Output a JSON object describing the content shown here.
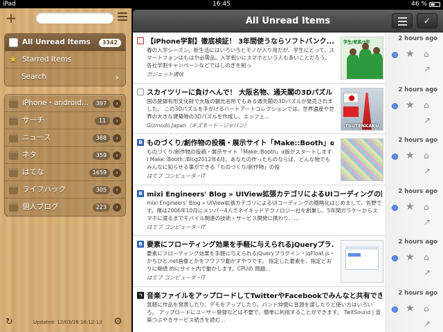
{
  "status_bar": {
    "device": "iPad",
    "time": "16:45",
    "battery": "46 %"
  },
  "sidebar": {
    "top_items": [
      {
        "label": "All Unread Items",
        "count": "3342"
      },
      {
        "label": "Starred Items"
      },
      {
        "label": "Search"
      }
    ],
    "folders": [
      {
        "label": "iPhone・android...",
        "count": "397"
      },
      {
        "label": "サーチ",
        "count": "11"
      },
      {
        "label": "ニュース",
        "count": "388"
      },
      {
        "label": "ネタ",
        "count": "359"
      },
      {
        "label": "はてな",
        "count": "1659"
      },
      {
        "label": "ライフハック",
        "count": "305"
      },
      {
        "label": "個人ブログ",
        "count": "223"
      }
    ],
    "updated": "Updated: 12/03/28 16:12:13"
  },
  "main": {
    "header_title": "All Unread Items",
    "items": [
      {
        "title": "【iPhone学割】徹底検証！ 3年間使うならソフトバンク...",
        "body": "春の入学シーズン。新生活にはいろいろとモノが入り用だが、学生にとって、スマートフォンはもはや必需品。入学祝いにスマホという人も多いことだろう。各社学割キャンペーンなどではしのぎを削っ",
        "source": "ガジェット通信",
        "time": "2 hours ago",
        "thumb_caption": "学生/家族/3年"
      },
      {
        "title": "スカイツリーに負けへんで！ 大阪名物、通天閣の3Dパズル",
        "body": "国の登録有形文化財で大阪の観光名所でもある通天閣の3Dパズルが発売されました。 この3Dパズルを手がけるハートアートコレクションでは、世界遺産や世界の大きな建築物の3Dパズルを作成し、エッフェ...",
        "source": "Gizmodo Japan（ギズモード・ジャパン）",
        "time": "2 hours ago",
        "thumb_caption": "TSUTENKAKU"
      },
      {
        "title": "ものづくり/創作物の投稿・展示サイト「Make::Booth」α...",
        "body": "ものづくり/創作物の投稿・展示サイト「Make::Booth」α版がスタートします I Make::Booth::Blog2012年4月、あなたの作ったものならば、どんな物でもみんなに知らせる事ができる「ものづくり/創作物」の投",
        "source": "はてブ コンピュータ・IT",
        "time": "2 hours ago"
      },
      {
        "title": "mixi Engineers' Blog » UIView拡張カテゴリによるUIコーディングの簡略化",
        "body": "mixi Engineers' Blog » UIView拡張カテゴリによるUIコーディングの簡略化はじめまして、佐野です。僕は2006年10月にメンバー4人でネイキッドテクノロジー社を創業し、5年間ガラケーからスマホに渡るまでモバイル関連の技術・サービス開発に携わり、...",
        "source": "はてブ コンピュータ・IT",
        "time": "2 hours ago"
      },
      {
        "title": "要素にフローティング効果を手軽に与えられるjQueryプラ...",
        "body": "要素にフローティング効果を手軽に与えられるjQueryプラグイン・jqFloat.js・かちびと.net画像とかをフワフワ動かすやつです。 指定した要素を、指定どおりに継続 的にサイト内で動かします。CPUの 問題...",
        "source": "はてブ コンピュータ・IT",
        "time": "2 hours ago"
      },
      {
        "title": "音楽ファイルをアップロードしてTwitterやFacebookでみんなと共有でき...",
        "body": "気軽に作品を発表したり、デモをアップしたり、バンド仲間に音源を渡したりと使い方はいろいろ。 アップロードにユーザー登録などは不要で、簡単に利用することができます。 TwitSound | 音楽つぶやきサービス続きを読む...",
        "source": "",
        "time": "2 hours ago"
      }
    ]
  },
  "icons": {
    "add": "plus-icon",
    "menu": "menu-icon",
    "refresh": "refresh-icon",
    "settings": "gear-icon",
    "star": "star-icon",
    "tag": "tag-icon",
    "share": "share-icon",
    "unread": "unread-dot-icon"
  },
  "colors": {
    "accent": "#5b8ee6",
    "header": "#4a4a4a",
    "wood": "#d8b07a"
  }
}
